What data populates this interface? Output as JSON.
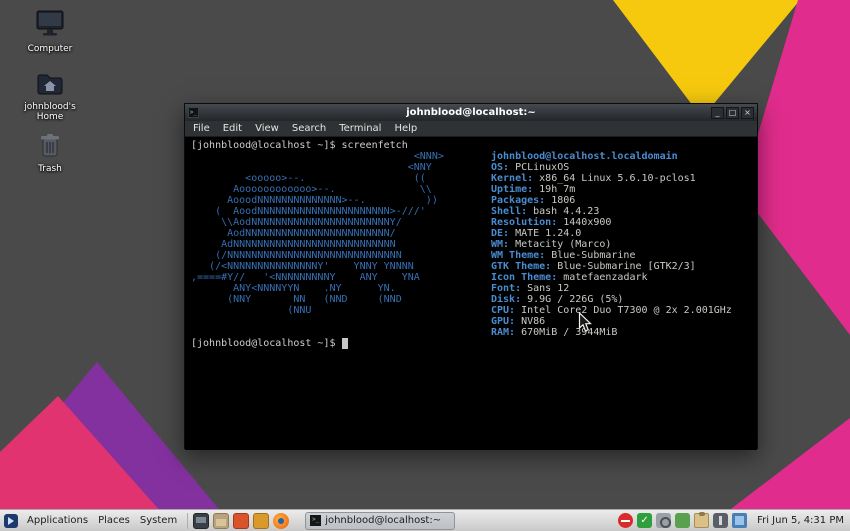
{
  "desktop": {
    "icons": [
      {
        "label": "Computer"
      },
      {
        "label": "johnblood's Home"
      },
      {
        "label": "Trash"
      }
    ]
  },
  "window": {
    "title": "johnblood@localhost:~",
    "controls": {
      "minimize": "_",
      "maximize": "□",
      "close": "×"
    }
  },
  "menu": {
    "items": [
      "File",
      "Edit",
      "View",
      "Search",
      "Terminal",
      "Help"
    ]
  },
  "terminal": {
    "prompt": "[johnblood@localhost ~]$",
    "command": "screenfetch",
    "ascii_art": "                                     <NNN>\n                                    <NNY\n         <ooooo>--.                  ((\n       Aoooooooooooo>--.              \\\\\n      AooodNNNNNNNNNNNNNN>--.          ))\n    (  AoodNNNNNNNNNNNNNNNNNNNNNN>-///'\n     \\\\AodNNNNNNNNNNNNNNNNNNNNNNNY/\n      AodNNNNNNNNNNNNNNNNNNNNNNNN/\n     AdNNNNNNNNNNNNNNNNNNNNNNNNNNN\n    (/NNNNNNNNNNNNNNNNNNNNNNNNNNNNN\n   (/<NNNNNNNNNNNNNNNY'    YNNY YNNNN\n,====#Y//   '<NNNNNNNNNY    ANY    YNA\n       ANY<NNNNYYN    .NY      YN.\n      (NNY       NN   (NND     (NND\n                (NNU",
    "header": "johnblood@localhost.localdomain",
    "rows": [
      {
        "label": "OS:",
        "value": "PCLinuxOS"
      },
      {
        "label": "Kernel:",
        "value": "x86_64 Linux 5.6.10-pclos1"
      },
      {
        "label": "Uptime:",
        "value": "19h 7m"
      },
      {
        "label": "Packages:",
        "value": "1806"
      },
      {
        "label": "Shell:",
        "value": "bash 4.4.23"
      },
      {
        "label": "Resolution:",
        "value": "1440x900"
      },
      {
        "label": "DE:",
        "value": "MATE 1.24.0"
      },
      {
        "label": "WM:",
        "value": "Metacity (Marco)"
      },
      {
        "label": "WM Theme:",
        "value": "Blue-Submarine"
      },
      {
        "label": "GTK Theme:",
        "value": "Blue-Submarine [GTK2/3]"
      },
      {
        "label": "Icon Theme:",
        "value": "matefaenzadark"
      },
      {
        "label": "Font:",
        "value": "Sans 12"
      },
      {
        "label": "Disk:",
        "value": "9.9G / 226G (5%)"
      },
      {
        "label": "CPU:",
        "value": "Intel Core2 Duo T7300 @ 2x 2.001GHz"
      },
      {
        "label": "GPU:",
        "value": "NV86"
      },
      {
        "label": "RAM:",
        "value": "670MiB / 3944MiB"
      }
    ]
  },
  "panel": {
    "menus": [
      "Applications",
      "Places",
      "System"
    ],
    "launcher_icons": [
      "screen-icon",
      "file-manager-icon",
      "package-icon",
      "amber-box-icon",
      "firefox-icon"
    ],
    "tray_icons": [
      "update-blocked-icon",
      "security-ok-icon",
      "search-icon",
      "network-icon",
      "clipboard-icon",
      "power-icon",
      "display-icon"
    ],
    "task_button": "johnblood@localhost:~",
    "tray_check": "✓",
    "clock": "Fri Jun 5, 4:31 PM"
  },
  "colors": {
    "wallpaper_gray": "#4a4a4a",
    "wallpaper_yellow": "#f6c90e",
    "wallpaper_magenta": "#e02c8c",
    "wallpaper_purple": "#83319f",
    "wallpaper_pink": "#e0336f",
    "screenfetch_blue": "#4a8cd0"
  }
}
